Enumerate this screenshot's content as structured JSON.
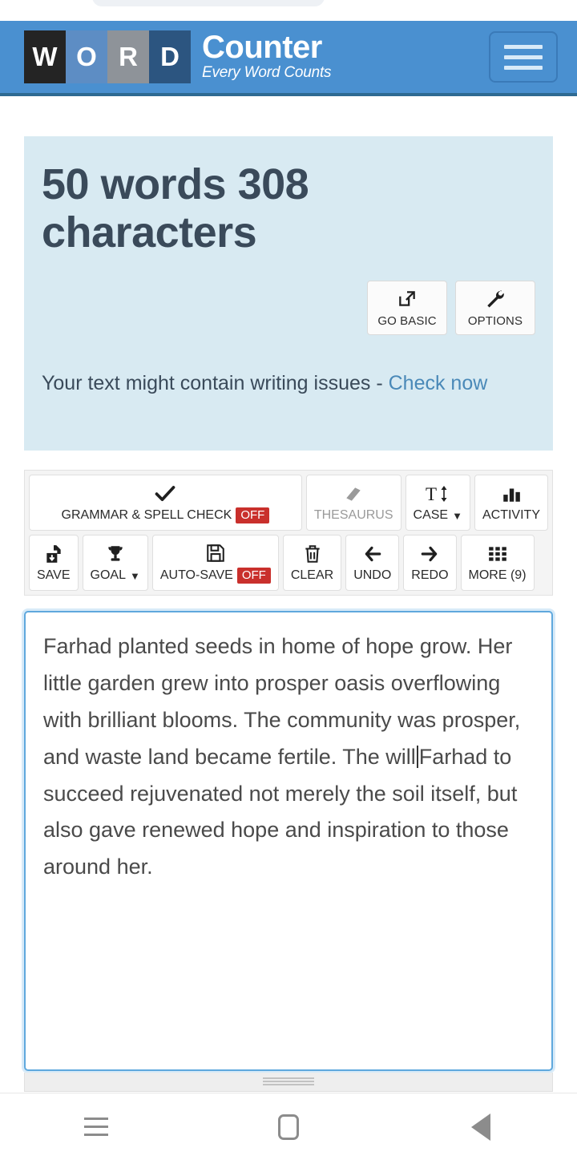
{
  "header": {
    "logo_tiles": [
      "W",
      "O",
      "R",
      "D"
    ],
    "brand_main": "Counter",
    "brand_tagline": "Every Word Counts",
    "menu_icon": "hamburger-menu-icon",
    "bg_color": "#4a90d0",
    "tile_colors": [
      "#242424",
      "#5d8dc4",
      "#8e9399",
      "#2c5580"
    ]
  },
  "stats_panel": {
    "bg_color": "#d8eaf2",
    "counts_text": "50 words 308 characters",
    "word_count": 50,
    "character_count": 308,
    "issues_text": "Your text might contain writing issues - ",
    "issues_link": "Check now",
    "link_color": "#4a89b8",
    "actions": [
      {
        "label": "GO BASIC",
        "icon": "external-link-icon"
      },
      {
        "label": "OPTIONS",
        "icon": "wrench-icon"
      }
    ]
  },
  "toolbar": {
    "row1": [
      {
        "label": "GRAMMAR & SPELL CHECK",
        "icon": "checkmark-icon",
        "badge": "OFF",
        "muted": false,
        "caret": false
      },
      {
        "label": "THESAURUS",
        "icon": "book-icon",
        "badge": null,
        "muted": true,
        "caret": false
      },
      {
        "label": "CASE",
        "icon": "text-size-icon",
        "badge": null,
        "muted": false,
        "caret": true
      },
      {
        "label": "ACTIVITY",
        "icon": "bar-chart-icon",
        "badge": null,
        "muted": false,
        "caret": false
      }
    ],
    "row2": [
      {
        "label": "SAVE",
        "icon": "file-download-icon",
        "badge": null,
        "muted": false,
        "caret": false
      },
      {
        "label": "GOAL",
        "icon": "trophy-icon",
        "badge": null,
        "muted": false,
        "caret": true
      },
      {
        "label": "AUTO-SAVE",
        "icon": "floppy-disk-icon",
        "badge": "OFF",
        "muted": false,
        "caret": false
      },
      {
        "label": "CLEAR",
        "icon": "trash-icon",
        "badge": null,
        "muted": false,
        "caret": false
      },
      {
        "label": "UNDO",
        "icon": "arrow-left-icon",
        "badge": null,
        "muted": false,
        "caret": false
      },
      {
        "label": "REDO",
        "icon": "arrow-right-icon",
        "badge": null,
        "muted": false,
        "caret": false
      },
      {
        "label": "MORE (9)",
        "icon": "grid-dots-icon",
        "badge": null,
        "muted": false,
        "caret": false
      }
    ],
    "badge_color": "#c9302c"
  },
  "editor": {
    "text_before_caret": "Farhad planted seeds in home of hope grow. Her little garden grew into prosper oasis overflowing with brilliant blooms. The community was prosper, and waste land became fertile. The will",
    "text_after_caret": "Farhad to succeed rejuvenated not merely the soil itself, but also gave renewed hope and inspiration to those around her.",
    "full_text": "Farhad planted seeds in home of hope grow. Her little garden grew into prosper oasis overflowing with brilliant blooms. The community was prosper, and waste land became fertile. The will Farhad to succeed rejuvenated not merely the soil itself, but also gave renewed hope and inspiration to those around her.",
    "focused": true,
    "border_color": "#5fa8dd"
  },
  "nav_bar": {
    "buttons": [
      {
        "name": "recents",
        "icon": "menu-lines-icon"
      },
      {
        "name": "home",
        "icon": "home-square-icon"
      },
      {
        "name": "back",
        "icon": "back-triangle-icon"
      }
    ]
  }
}
